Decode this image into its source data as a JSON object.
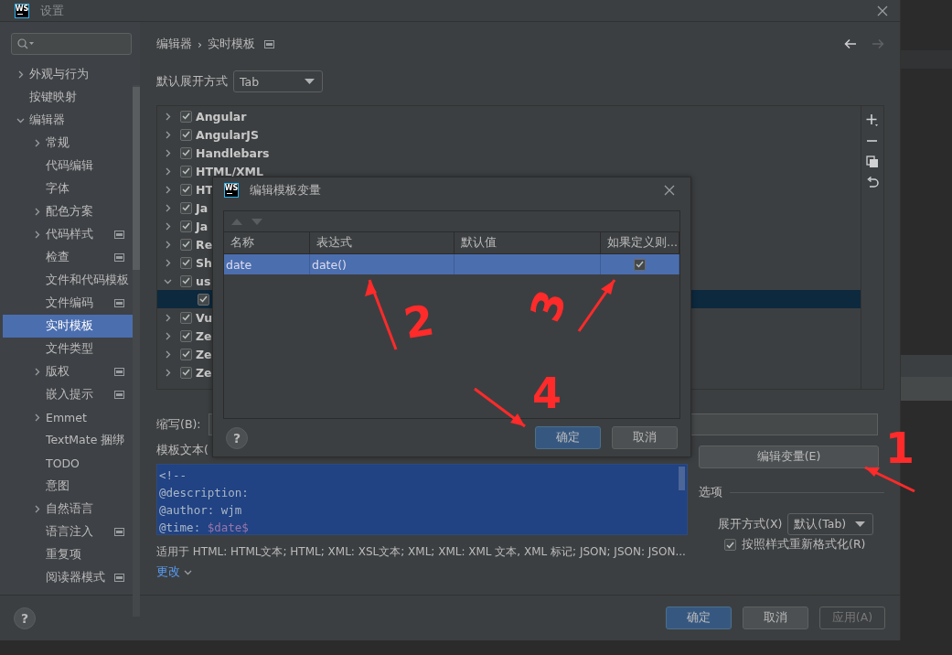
{
  "window": {
    "logo": "WS",
    "title": "设置"
  },
  "sidebar": {
    "items": [
      {
        "label": "外观与行为",
        "expanded": false,
        "badge": false,
        "selected": false
      },
      {
        "label": "按键映射",
        "badge": false,
        "selected": false
      },
      {
        "label": "编辑器",
        "expanded": true,
        "badge": false,
        "selected": false,
        "children": [
          {
            "label": "常规",
            "expanded": false,
            "badge": false,
            "selected": false
          },
          {
            "label": "代码编辑",
            "badge": false,
            "selected": false
          },
          {
            "label": "字体",
            "badge": false,
            "selected": false
          },
          {
            "label": "配色方案",
            "expanded": false,
            "badge": false,
            "selected": false
          },
          {
            "label": "代码样式",
            "expanded": false,
            "badge": true,
            "selected": false
          },
          {
            "label": "检查",
            "badge": true,
            "selected": false
          },
          {
            "label": "文件和代码模板",
            "badge": false,
            "selected": false
          },
          {
            "label": "文件编码",
            "badge": true,
            "selected": false
          },
          {
            "label": "实时模板",
            "badge": false,
            "selected": true
          },
          {
            "label": "文件类型",
            "badge": false,
            "selected": false
          },
          {
            "label": "版权",
            "expanded": false,
            "badge": true,
            "selected": false
          },
          {
            "label": "嵌入提示",
            "badge": true,
            "selected": false
          },
          {
            "label": "Emmet",
            "expanded": false,
            "badge": false,
            "selected": false
          },
          {
            "label": "TextMate 捆绑",
            "badge": false,
            "selected": false
          },
          {
            "label": "TODO",
            "badge": false,
            "selected": false
          },
          {
            "label": "意图",
            "badge": false,
            "selected": false
          },
          {
            "label": "自然语言",
            "expanded": false,
            "badge": false,
            "selected": false
          },
          {
            "label": "语言注入",
            "badge": true,
            "selected": false
          },
          {
            "label": "重复项",
            "badge": false,
            "selected": false
          },
          {
            "label": "阅读器模式",
            "badge": true,
            "selected": false
          }
        ]
      }
    ]
  },
  "breadcrumb": {
    "parts": [
      "编辑器",
      "实时模板"
    ],
    "separator": "›"
  },
  "expand_default": {
    "label": "默认展开方式",
    "value": "Tab"
  },
  "template_tree": [
    {
      "label": "Angular",
      "checked": true,
      "expanded": false,
      "selected": false
    },
    {
      "label": "AngularJS",
      "checked": true,
      "expanded": false,
      "selected": false
    },
    {
      "label": "Handlebars",
      "checked": true,
      "expanded": false,
      "selected": false
    },
    {
      "label": "HTML/XML",
      "checked": true,
      "expanded": false,
      "selected": false
    },
    {
      "label": "HT",
      "checked": true,
      "expanded": false,
      "selected": false
    },
    {
      "label": "Ja",
      "checked": true,
      "expanded": false,
      "selected": false
    },
    {
      "label": "Ja",
      "checked": true,
      "expanded": false,
      "selected": false
    },
    {
      "label": "Re",
      "checked": true,
      "expanded": false,
      "selected": false
    },
    {
      "label": "Sh",
      "checked": true,
      "expanded": false,
      "selected": false
    },
    {
      "label": "us",
      "checked": true,
      "expanded": true,
      "selected": false,
      "children": [
        {
          "checked": true,
          "selected": true
        }
      ]
    },
    {
      "label": "Vu",
      "checked": true,
      "expanded": false,
      "selected": false
    },
    {
      "label": "Ze",
      "checked": true,
      "expanded": false,
      "selected": false
    },
    {
      "label": "Ze",
      "checked": true,
      "expanded": false,
      "selected": false
    },
    {
      "label": "Ze",
      "checked": true,
      "expanded": false,
      "selected": false
    }
  ],
  "abbreviation": {
    "label": "缩写(B):"
  },
  "template_text": {
    "label": "模板文本(",
    "lines": [
      {
        "text": "<!--"
      },
      {
        "text": "@description:"
      },
      {
        "text": "@author: wjm"
      },
      {
        "text": "@time: ",
        "variable": "$date$"
      }
    ]
  },
  "applicable": "适用于 HTML: HTML文本; HTML; XML: XSL文本; XML; XML: XML 文本, XML 标记; JSON; JSON: JSON...",
  "change_link": "更改",
  "edit_variables_button": "编辑变量(E)",
  "options": {
    "title": "选项",
    "expand_with": {
      "label": "展开方式(X)",
      "value": "默认(Tab)"
    },
    "reformat": {
      "label": "按照样式重新格式化(R)",
      "checked": true
    }
  },
  "footer": {
    "help": "?",
    "buttons": [
      {
        "label": "确定",
        "kind": "primary"
      },
      {
        "label": "取消",
        "kind": "normal"
      },
      {
        "label": "应用(A)",
        "kind": "disabled"
      }
    ]
  },
  "dialog": {
    "logo": "WS",
    "title": "编辑模板变量",
    "columns": [
      "名称",
      "表达式",
      "默认值",
      "如果定义则..."
    ],
    "rows": [
      {
        "name": "date",
        "expression": "date()",
        "skip_if_defined": true,
        "selected": true
      }
    ],
    "help": "?",
    "buttons": [
      {
        "label": "确定",
        "kind": "primary"
      },
      {
        "label": "取消",
        "kind": "normal"
      }
    ]
  },
  "annotations": [
    {
      "label": "1"
    },
    {
      "label": "2"
    },
    {
      "label": "3"
    },
    {
      "label": "4"
    }
  ]
}
